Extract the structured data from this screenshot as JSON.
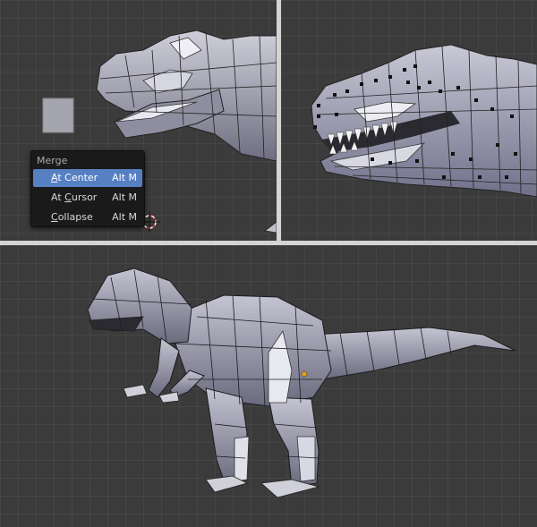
{
  "merge_menu": {
    "title": "Merge",
    "items": [
      {
        "pre": "",
        "key": "A",
        "post": "t Center",
        "shortcut": "Alt M",
        "active": true
      },
      {
        "pre": "At ",
        "key": "C",
        "post": "ursor",
        "shortcut": "Alt M",
        "active": false
      },
      {
        "pre": "",
        "key": "C",
        "post": "ollapse",
        "shortcut": "Alt M",
        "active": false
      }
    ]
  },
  "colors": {
    "viewport_bg": "#3b3b3b",
    "menu_bg": "#1a1a1a",
    "menu_highlight": "#5680c2",
    "mesh_face": "#a0a0b0",
    "mesh_edge": "#1c1c22",
    "separator": "#d4d4d4"
  }
}
